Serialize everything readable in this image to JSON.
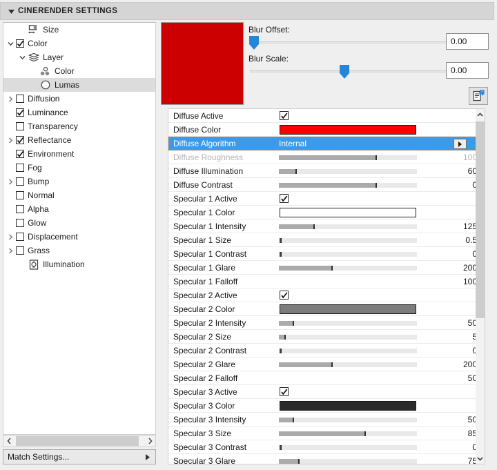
{
  "window": {
    "title": "CINERENDER SETTINGS",
    "collapse_icon": "triangle-down-icon"
  },
  "tree": {
    "items": [
      {
        "label": "Size",
        "indent": 1,
        "twisty": "none",
        "control": "icon",
        "icon": "size-icon",
        "checked": false,
        "selected": false
      },
      {
        "label": "Color",
        "indent": 0,
        "twisty": "open",
        "control": "checkbox",
        "icon": "",
        "checked": true,
        "selected": false
      },
      {
        "label": "Layer",
        "indent": 1,
        "twisty": "open",
        "control": "icon",
        "icon": "layers-icon",
        "checked": false,
        "selected": false
      },
      {
        "label": "Color",
        "indent": 2,
        "twisty": "none",
        "control": "icon",
        "icon": "color-nodes-icon",
        "checked": false,
        "selected": false
      },
      {
        "label": "Lumas",
        "indent": 2,
        "twisty": "none",
        "control": "icon",
        "icon": "sphere-icon",
        "checked": false,
        "selected": true
      },
      {
        "label": "Diffusion",
        "indent": 0,
        "twisty": "closed",
        "control": "checkbox",
        "icon": "",
        "checked": false,
        "selected": false
      },
      {
        "label": "Luminance",
        "indent": 0,
        "twisty": "none",
        "control": "checkbox",
        "icon": "",
        "checked": true,
        "selected": false
      },
      {
        "label": "Transparency",
        "indent": 0,
        "twisty": "none",
        "control": "checkbox",
        "icon": "",
        "checked": false,
        "selected": false
      },
      {
        "label": "Reflectance",
        "indent": 0,
        "twisty": "closed",
        "control": "checkbox",
        "icon": "",
        "checked": true,
        "selected": false
      },
      {
        "label": "Environment",
        "indent": 0,
        "twisty": "none",
        "control": "checkbox",
        "icon": "",
        "checked": true,
        "selected": false
      },
      {
        "label": "Fog",
        "indent": 0,
        "twisty": "none",
        "control": "checkbox",
        "icon": "",
        "checked": false,
        "selected": false
      },
      {
        "label": "Bump",
        "indent": 0,
        "twisty": "closed",
        "control": "checkbox",
        "icon": "",
        "checked": false,
        "selected": false
      },
      {
        "label": "Normal",
        "indent": 0,
        "twisty": "none",
        "control": "checkbox",
        "icon": "",
        "checked": false,
        "selected": false
      },
      {
        "label": "Alpha",
        "indent": 0,
        "twisty": "none",
        "control": "checkbox",
        "icon": "",
        "checked": false,
        "selected": false
      },
      {
        "label": "Glow",
        "indent": 0,
        "twisty": "none",
        "control": "checkbox",
        "icon": "",
        "checked": false,
        "selected": false
      },
      {
        "label": "Displacement",
        "indent": 0,
        "twisty": "closed",
        "control": "checkbox",
        "icon": "",
        "checked": false,
        "selected": false
      },
      {
        "label": "Grass",
        "indent": 0,
        "twisty": "closed",
        "control": "checkbox",
        "icon": "",
        "checked": false,
        "selected": false
      },
      {
        "label": "Illumination",
        "indent": 1,
        "twisty": "none",
        "control": "icon",
        "icon": "bulb-icon",
        "checked": false,
        "selected": false
      }
    ]
  },
  "tree_scrollbar": {
    "left_icon": "chevron-left-icon",
    "right_icon": "chevron-right-icon"
  },
  "match_settings": {
    "label": "Match Settings...",
    "arrow_icon": "triangle-right-icon"
  },
  "preview": {
    "color": "#CC0000"
  },
  "blur": {
    "offset_label": "Blur Offset:",
    "offset_value": "0.00",
    "offset_knob_pct": 2,
    "scale_label": "Blur Scale:",
    "scale_value": "0.00",
    "scale_knob_pct": 48,
    "doc_button_icon": "document-arrow-icon"
  },
  "properties": {
    "rows": [
      {
        "name": "Diffuse Active",
        "kind": "checkbox",
        "checked": true,
        "value": "",
        "dim": false,
        "selected": false
      },
      {
        "name": "Diffuse Color",
        "kind": "swatch",
        "color": "#FF0000",
        "value": "",
        "dim": false,
        "selected": false
      },
      {
        "name": "Diffuse Algorithm",
        "kind": "dropdown",
        "value": "Internal",
        "dim": false,
        "selected": true,
        "dropdown_icon": "triangle-right-icon"
      },
      {
        "name": "Diffuse Roughness",
        "kind": "slider",
        "fill_pct": 70,
        "value": "100",
        "dim": true,
        "selected": false
      },
      {
        "name": "Diffuse Illumination",
        "kind": "slider",
        "fill_pct": 12,
        "value": "60",
        "dim": false,
        "selected": false
      },
      {
        "name": "Diffuse Contrast",
        "kind": "slider",
        "fill_pct": 70,
        "value": "0",
        "dim": false,
        "selected": false
      },
      {
        "name": "Specular 1 Active",
        "kind": "checkbox",
        "checked": true,
        "value": "",
        "dim": false,
        "selected": false
      },
      {
        "name": "Specular 1 Color",
        "kind": "swatch",
        "color": "#FFFFFF",
        "value": "",
        "dim": false,
        "selected": false
      },
      {
        "name": "Specular 1 Intensity",
        "kind": "slider",
        "fill_pct": 25,
        "value": "125",
        "dim": false,
        "selected": false
      },
      {
        "name": "Specular 1 Size",
        "kind": "slider",
        "fill_pct": 1,
        "value": "0.5",
        "dim": false,
        "selected": false
      },
      {
        "name": "Specular 1 Contrast",
        "kind": "slider",
        "fill_pct": 1,
        "value": "0",
        "dim": false,
        "selected": false
      },
      {
        "name": "Specular 1 Glare",
        "kind": "slider",
        "fill_pct": 38,
        "value": "200",
        "dim": false,
        "selected": false
      },
      {
        "name": "Specular 1 Falloff",
        "kind": "plain",
        "value": "100",
        "dim": false,
        "selected": false
      },
      {
        "name": "Specular 2 Active",
        "kind": "checkbox",
        "checked": true,
        "value": "",
        "dim": false,
        "selected": false
      },
      {
        "name": "Specular 2 Color",
        "kind": "swatch",
        "color": "#7C7C7C",
        "value": "",
        "dim": false,
        "selected": false
      },
      {
        "name": "Specular 2 Intensity",
        "kind": "slider",
        "fill_pct": 10,
        "value": "50",
        "dim": false,
        "selected": false
      },
      {
        "name": "Specular 2 Size",
        "kind": "slider",
        "fill_pct": 4,
        "value": "5",
        "dim": false,
        "selected": false
      },
      {
        "name": "Specular 2 Contrast",
        "kind": "slider",
        "fill_pct": 1,
        "value": "0",
        "dim": false,
        "selected": false
      },
      {
        "name": "Specular 2 Glare",
        "kind": "slider",
        "fill_pct": 38,
        "value": "200",
        "dim": false,
        "selected": false
      },
      {
        "name": "Specular 2 Falloff",
        "kind": "plain",
        "value": "50",
        "dim": false,
        "selected": false
      },
      {
        "name": "Specular 3 Active",
        "kind": "checkbox",
        "checked": true,
        "value": "",
        "dim": false,
        "selected": false
      },
      {
        "name": "Specular 3 Color",
        "kind": "swatch",
        "color": "#2B2B2B",
        "value": "",
        "dim": false,
        "selected": false
      },
      {
        "name": "Specular 3 Intensity",
        "kind": "slider",
        "fill_pct": 10,
        "value": "50",
        "dim": false,
        "selected": false
      },
      {
        "name": "Specular 3 Size",
        "kind": "slider",
        "fill_pct": 62,
        "value": "85",
        "dim": false,
        "selected": false
      },
      {
        "name": "Specular 3 Contrast",
        "kind": "slider",
        "fill_pct": 1,
        "value": "0",
        "dim": false,
        "selected": false
      },
      {
        "name": "Specular 3 Glare",
        "kind": "slider",
        "fill_pct": 14,
        "value": "75",
        "dim": false,
        "selected": false
      }
    ]
  },
  "properties_scrollbar": {
    "up_icon": "chevron-up-icon",
    "down_icon": "chevron-down-icon"
  },
  "colors": {
    "selection_blue": "#3D9AE8",
    "accent_red": "#FF0000",
    "preview_red": "#CC0000"
  }
}
